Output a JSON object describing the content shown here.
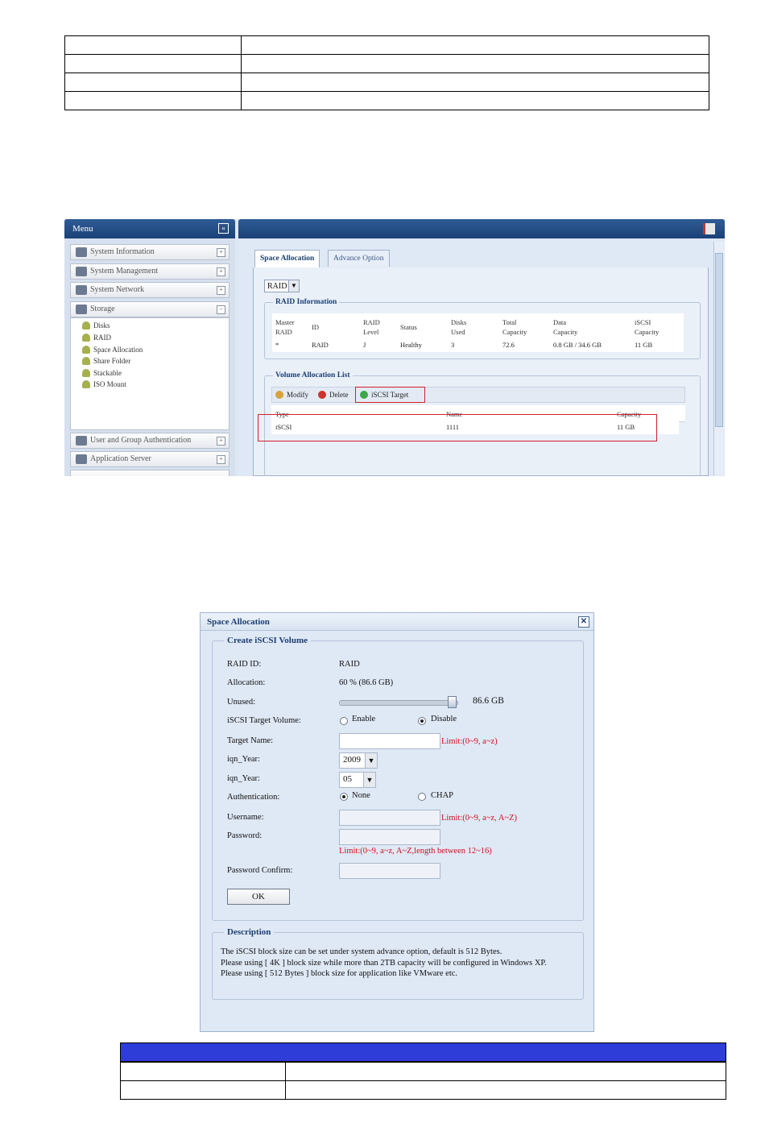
{
  "top_table": {
    "rows": 4
  },
  "screenshot1": {
    "menu": {
      "title": "Menu",
      "collapse_glyph": "«",
      "items": [
        {
          "label": "System Information",
          "toggle": "+"
        },
        {
          "label": "System Management",
          "toggle": "+"
        },
        {
          "label": "System Network",
          "toggle": "+"
        },
        {
          "label": "Storage",
          "toggle": "−"
        }
      ],
      "storage_children": [
        "Disks",
        "RAID",
        "Space Allocation",
        "Share Folder",
        "Stackable",
        "ISO Mount"
      ],
      "bottom_items": [
        {
          "label": "User and Group Authentication",
          "toggle": "+"
        },
        {
          "label": "Application Server",
          "toggle": "+"
        }
      ]
    },
    "tabs": [
      "Space Allocation",
      "Advance Option"
    ],
    "raid_select": "RAID",
    "raid_info": {
      "legend": "RAID Information",
      "headers": [
        [
          "Master",
          "RAID"
        ],
        [
          "ID",
          ""
        ],
        [
          "RAID",
          "Level"
        ],
        [
          "Status",
          ""
        ],
        [
          "Disks",
          "Used"
        ],
        [
          "Total",
          "Capacity"
        ],
        [
          "Data",
          "Capacity"
        ],
        [
          "iSCSI",
          "Capacity"
        ]
      ],
      "row": [
        "*",
        "RAID",
        "J",
        "Healthy",
        "3",
        "72.6",
        "0.8 GB / 34.6 GB",
        "11 GB"
      ]
    },
    "volume_list": {
      "legend": "Volume Allocation List",
      "buttons": {
        "modify": "Modify",
        "delete": "Delete",
        "iscsi": "iSCSI Target"
      },
      "headers": [
        "Type",
        "Name",
        "Capacity"
      ],
      "row": [
        "iSCSI",
        "1111",
        "11 GB"
      ]
    }
  },
  "dialog": {
    "title": "Space Allocation",
    "close_glyph": "✕",
    "section_title": "Create iSCSI Volume",
    "raid_id_label": "RAID ID:",
    "raid_id_value": "RAID",
    "allocation_label": "Allocation:",
    "allocation_value": "60 % (86.6 GB)",
    "unused_label": "Unused:",
    "unused_value": "86.6 GB",
    "slider_fraction": 1.0,
    "target_volume_label": "iSCSI Target Volume:",
    "enable_label": "Enable",
    "disable_label": "Disable",
    "target_name_label": "Target Name:",
    "target_name_limit": "Limit:(0~9, a~z)",
    "iqn_year_label": "iqn_Year:",
    "iqn_year_value": "2009",
    "iqn_month_label": "iqn_Year:",
    "iqn_month_value": "05",
    "auth_label": "Authentication:",
    "auth_none": "None",
    "auth_chap": "CHAP",
    "username_label": "Username:",
    "username_limit": "Limit:(0~9, a~z, A~Z)",
    "password_label": "Password:",
    "password_limit": "Limit:(0~9, a~z, A~Z,length between 12~16)",
    "password_confirm_label": "Password Confirm:",
    "ok_label": "OK",
    "description_title": "Description",
    "description_lines": [
      "The iSCSI block size can be set under system advance option, default is 512 Bytes.",
      "Please using [ 4K ] block size while more than 2TB capacity will be configured in Windows XP.",
      "Please using [ 512 Bytes ] block size for application like VMware etc."
    ]
  },
  "bottom_table": {
    "rows": 2
  },
  "colors": {
    "header_blue": "#2e3cd8",
    "highlight_red": "#d21f2b",
    "menu_blue": "#1b4177"
  }
}
